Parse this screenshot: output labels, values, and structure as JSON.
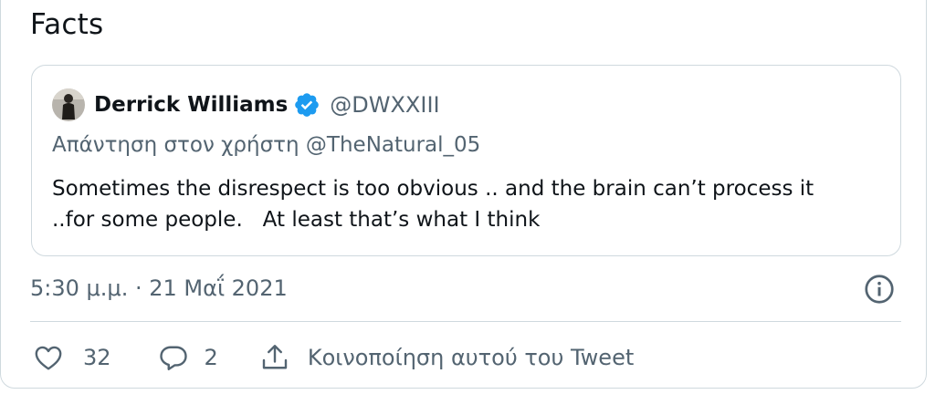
{
  "tweet": {
    "text": "Facts",
    "timestamp": "5:30 μ.μ. · 21 Μαΐ 2021"
  },
  "quoted_tweet": {
    "author_name": "Derrick Williams",
    "author_handle": "@DWXXIII",
    "reply_prefix": "Απάντηση στον χρήστη",
    "reply_mention": "@TheNatural_05",
    "body_line1": "Sometimes the disrespect is too obvious .. and the brain can’t process it",
    "body_line2": "..for some people.   At least that’s what I think"
  },
  "actions": {
    "like_count": "32",
    "reply_count": "2",
    "share_label": "Κοινοποίηση αυτού του Tweet"
  },
  "icons": {
    "verified": "verified-badge-icon",
    "info": "info-icon",
    "like": "heart-icon",
    "reply": "speech-bubble-icon",
    "share": "share-icon"
  },
  "colors": {
    "verified_blue": "#1d9bf0",
    "secondary_text": "#536471",
    "primary_text": "#0f1419",
    "border": "#cfd9de"
  }
}
